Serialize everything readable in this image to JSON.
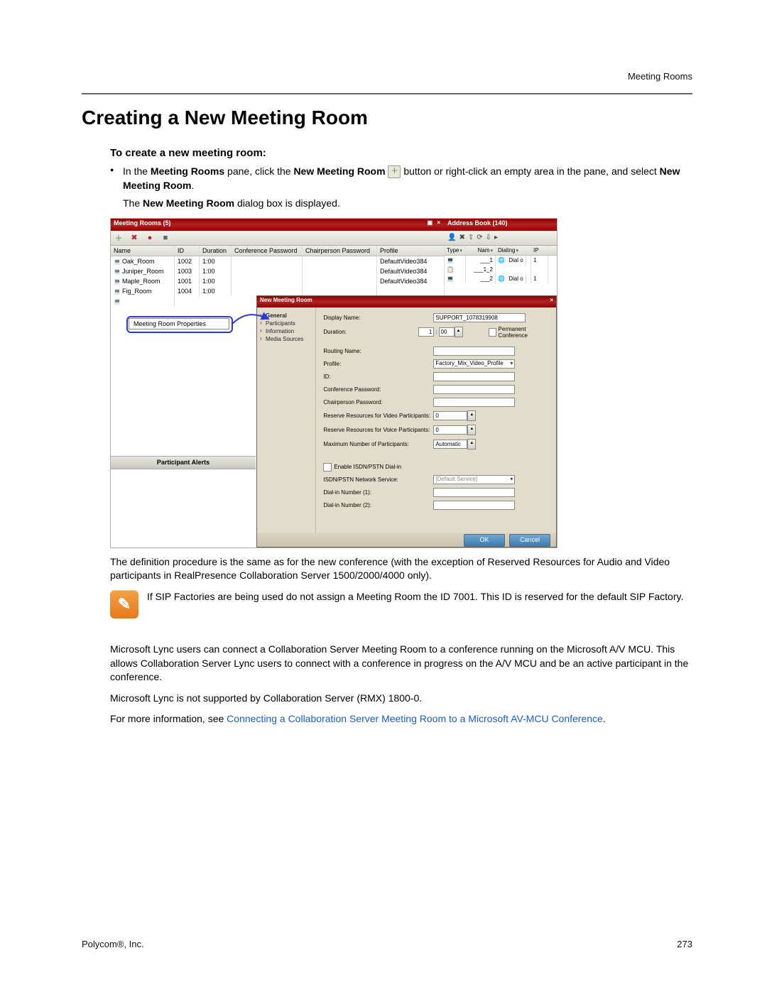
{
  "header": {
    "section": "Meeting Rooms"
  },
  "title": "Creating a New Meeting Room",
  "subtitle": "To create a new meeting room:",
  "bullet": {
    "pre": "In the ",
    "b1": "Meeting Rooms",
    "mid1": " pane, click the ",
    "b2": "New Meeting Room",
    "mid2": " button or right-click an empty area in the pane, and select ",
    "b3": "New Meeting Room",
    "end": "."
  },
  "line_displayed_pre": "The ",
  "line_displayed_b": "New Meeting Room",
  "line_displayed_post": " dialog box is displayed.",
  "meeting_rooms": {
    "title": "Meeting Rooms (5)",
    "pin": "▣  ×",
    "columns": [
      "Name",
      "ID",
      "Duration",
      "Conference Password",
      "Chairperson Password",
      "Profile"
    ],
    "rows": [
      {
        "name": "Oak_Room",
        "id": "1002",
        "dur": "1:00",
        "cpw": "",
        "chp": "",
        "pro": "DefaultVideo384"
      },
      {
        "name": "Juniper_Room",
        "id": "1003",
        "dur": "1:00",
        "cpw": "",
        "chp": "",
        "pro": "DefaultVideo384"
      },
      {
        "name": "Maple_Room",
        "id": "1001",
        "dur": "1:00",
        "cpw": "",
        "chp": "",
        "pro": "DefaultVideo384"
      },
      {
        "name": "Fig_Room",
        "id": "1004",
        "dur": "1:00",
        "cpw": "",
        "chp": "",
        "pro": ""
      }
    ],
    "context_item": "Meeting Room Properties",
    "participant_alerts": "Participant Alerts"
  },
  "address_book": {
    "title": "Address Book (140)",
    "columns": [
      "Type",
      "Nam",
      "Dialing",
      "IP"
    ],
    "rows": [
      {
        "name": "___1",
        "dial": "Dial o",
        "ip": "1"
      },
      {
        "name": "___1_2",
        "dial": "",
        "ip": ""
      },
      {
        "name": "___2",
        "dial": "Dial o",
        "ip": "1"
      }
    ]
  },
  "dialog": {
    "title": "New Meeting Room",
    "close": "×",
    "nav": [
      "General",
      "Participants",
      "Information",
      "Media Sources"
    ],
    "fields": {
      "display_name": {
        "label": "Display Name:",
        "value": "SUPPORT_1078319908"
      },
      "duration": {
        "label": "Duration:",
        "h": "1",
        "m": "00",
        "perm": "Permanent Conference"
      },
      "routing": {
        "label": "Routing Name:",
        "value": ""
      },
      "profile": {
        "label": "Profile:",
        "value": "Factory_Mix_Video_Profile"
      },
      "id": {
        "label": "ID:",
        "value": ""
      },
      "conf_pw": {
        "label": "Conference Password:",
        "value": ""
      },
      "chair_pw": {
        "label": "Chairperson Password:",
        "value": ""
      },
      "res_video": {
        "label": "Reserve Resources for Video Participants:",
        "value": "0"
      },
      "res_voice": {
        "label": "Reserve Resources for Voice Participants:",
        "value": "0"
      },
      "max_part": {
        "label": "Maximum Number of Participants:",
        "value": "Automatic"
      },
      "enable_isdn": {
        "label": "Enable ISDN/PSTN Dial-in"
      },
      "isdn_service": {
        "label": "ISDN/PSTN Network Service:",
        "value": "[Default Service]"
      },
      "dial1": {
        "label": "Dial-in Number (1):",
        "value": ""
      },
      "dial2": {
        "label": "Dial-in Number (2):",
        "value": ""
      }
    },
    "ok": "OK",
    "cancel": "Cancel"
  },
  "body_after_figure": "The definition procedure is the same as for the new conference (with the exception of Reserved Resources for Audio and Video participants in RealPresence Collaboration Server 1500/2000/4000 only).",
  "note": "If SIP Factories are being used do not assign a Meeting Room the ID 7001. This ID is reserved for the default SIP Factory.",
  "para_lync1": "Microsoft Lync users can connect a Collaboration Server Meeting Room to a conference running on the Microsoft A/V MCU. This allows Collaboration Server Lync users to connect with a conference in progress on the A/V MCU and be an active participant in the conference.",
  "para_lync2": "Microsoft Lync is not supported by Collaboration Server (RMX) 1800-0.",
  "para_more_pre": "For more information, see ",
  "para_more_link": "Connecting a Collaboration Server Meeting Room to a Microsoft AV-MCU Conference",
  "para_more_post": ".",
  "footer": {
    "company": "Polycom®, Inc.",
    "page": "273"
  }
}
